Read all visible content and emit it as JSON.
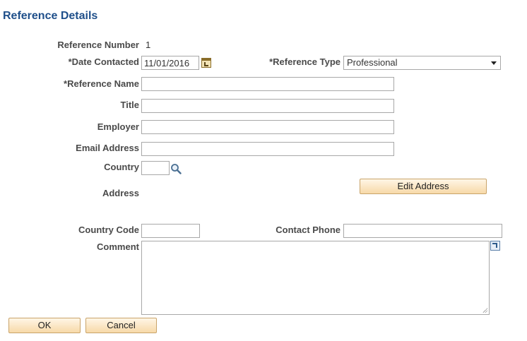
{
  "page": {
    "title": "Reference Details"
  },
  "form": {
    "reference_number": {
      "label": "Reference Number",
      "value": "1"
    },
    "date_contacted": {
      "label": "*Date Contacted",
      "value": "11/01/2016"
    },
    "reference_type": {
      "label": "*Reference Type",
      "value": "Professional"
    },
    "reference_name": {
      "label": "*Reference Name",
      "value": ""
    },
    "title": {
      "label": "Title",
      "value": ""
    },
    "employer": {
      "label": "Employer",
      "value": ""
    },
    "email_address": {
      "label": "Email Address",
      "value": ""
    },
    "country": {
      "label": "Country",
      "value": ""
    },
    "address": {
      "label": "Address"
    },
    "edit_address_label": "Edit Address",
    "country_code": {
      "label": "Country Code",
      "value": ""
    },
    "contact_phone": {
      "label": "Contact Phone",
      "value": ""
    },
    "comment": {
      "label": "Comment",
      "value": ""
    }
  },
  "actions": {
    "ok_label": "OK",
    "cancel_label": "Cancel"
  },
  "icons": {
    "calendar": "calendar-icon",
    "lookup": "search-icon",
    "expand": "expand-icon",
    "dropdown": "chevron-down-icon"
  },
  "colors": {
    "title": "#1f4f8a",
    "button_fill": "#f7d9a8",
    "button_border": "#c9a46a",
    "input_border": "#a8a8a8"
  }
}
